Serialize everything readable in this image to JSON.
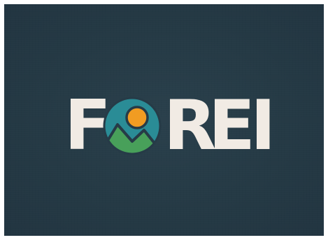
{
  "logo": {
    "wordmark": "FOREI",
    "letters": [
      "F",
      "O",
      "R",
      "E",
      "I"
    ],
    "emblem": "mountain-sun-icon",
    "colors": {
      "background": "#263b47",
      "letters": "#f1ebe4",
      "emblem_sky": "#2a8c96",
      "emblem_sun": "#f19c22",
      "emblem_mountains": "#48a05a",
      "emblem_outline": "#263b47"
    }
  }
}
